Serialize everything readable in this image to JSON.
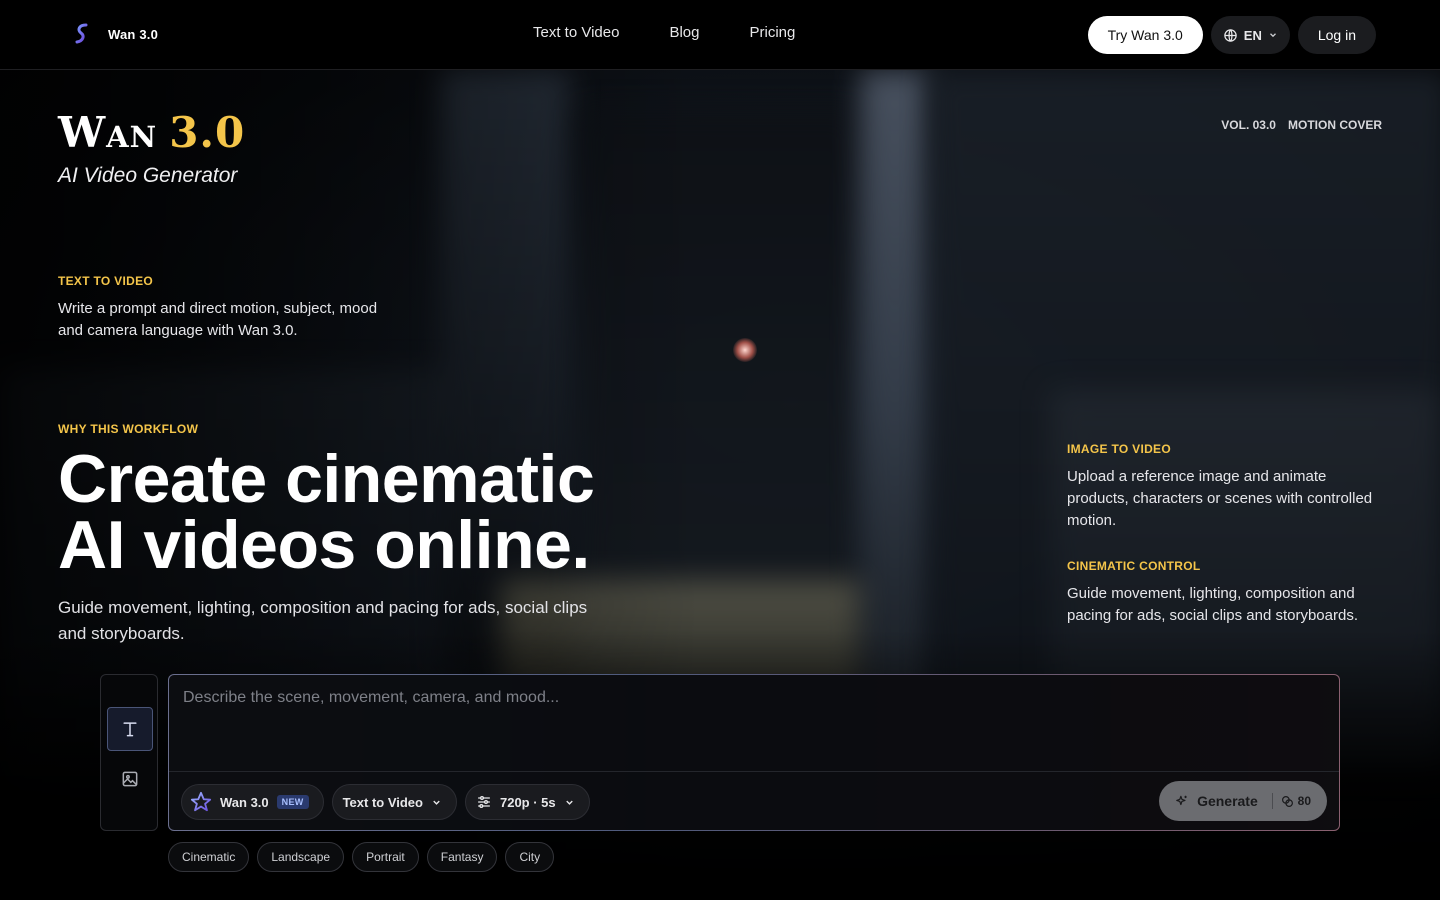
{
  "header": {
    "brand": "Wan 3.0",
    "nav": [
      {
        "label": "Text to Video"
      },
      {
        "label": "Blog"
      },
      {
        "label": "Pricing"
      }
    ],
    "try_label": "Try Wan 3.0",
    "lang_label": "EN",
    "login_label": "Log in"
  },
  "hero": {
    "logo_word": "Wan",
    "logo_version": "3.0",
    "logo_sub": "AI Video Generator",
    "vol": "VOL. 03.0",
    "cover": "MOTION COVER",
    "t2v": {
      "eyebrow": "TEXT TO VIDEO",
      "text": "Write a prompt and direct motion, subject, mood and camera language with Wan 3.0."
    },
    "why_eyebrow": "WHY THIS WORKFLOW",
    "headline_line1": "Create cinematic",
    "headline_line2": "AI videos online.",
    "subline": "Guide movement, lighting, composition and pacing for ads, social clips and storyboards.",
    "i2v": {
      "eyebrow": "IMAGE TO VIDEO",
      "text": "Upload a reference image and animate products, characters or scenes with controlled motion."
    },
    "cinematic": {
      "eyebrow": "CINEMATIC CONTROL",
      "text": "Guide movement, lighting, composition and pacing for ads, social clips and storyboards."
    }
  },
  "composer": {
    "placeholder": "Describe the scene, movement, camera, and mood...",
    "model_label": "Wan 3.0",
    "model_badge": "NEW",
    "mode_label": "Text to Video",
    "settings_label": "720p · 5s",
    "generate_label": "Generate",
    "credits": "80"
  },
  "chips": [
    "Cinematic",
    "Landscape",
    "Portrait",
    "Fantasy",
    "City"
  ],
  "colors": {
    "accent": "#f4c54a",
    "background": "#000000"
  }
}
